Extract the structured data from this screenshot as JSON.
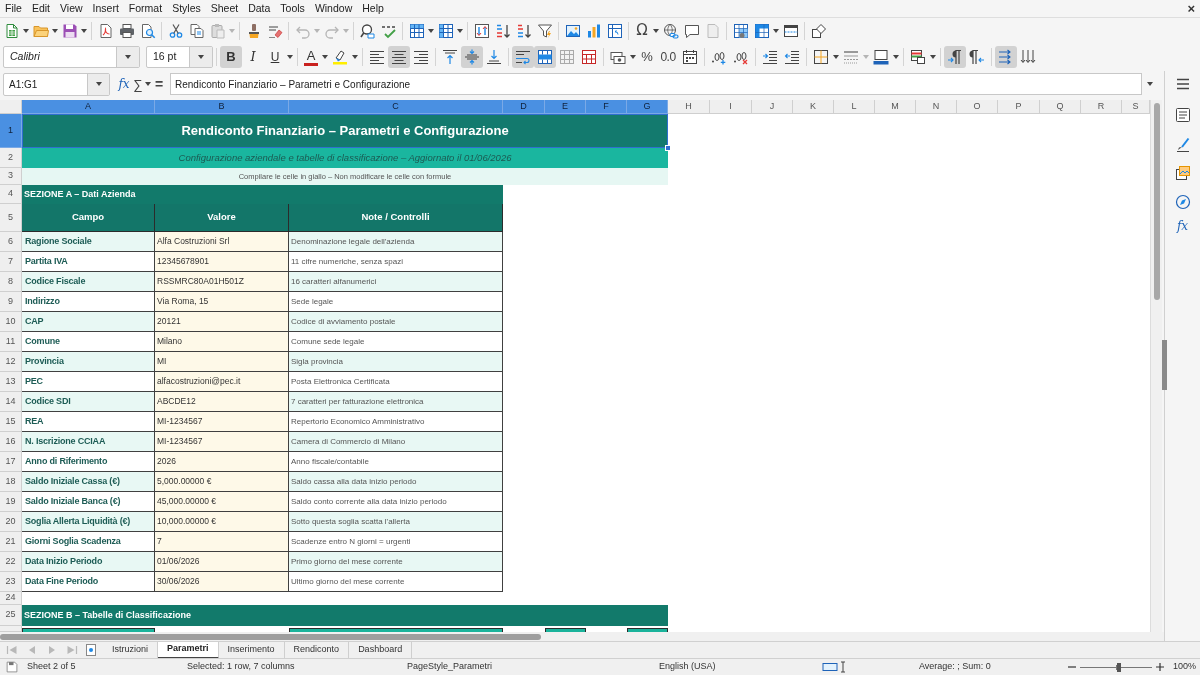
{
  "menu_bar": {
    "items": [
      "File",
      "Edit",
      "View",
      "Insert",
      "Format",
      "Styles",
      "Sheet",
      "Data",
      "Tools",
      "Window",
      "Help"
    ],
    "close_label": "×"
  },
  "standard_toolbar": {
    "special_character_label": "Ω"
  },
  "formatting_toolbar": {
    "font_name": "Calibri",
    "font_size": "16 pt",
    "text_styles": [
      {
        "kind": "bold",
        "label": "B",
        "on": true
      },
      {
        "kind": "italic",
        "label": "I",
        "on": false
      },
      {
        "kind": "underline",
        "label": "U",
        "on": false
      }
    ],
    "font_color_label": "A",
    "horizontal_align": [
      {
        "kind": "left",
        "selected": false
      },
      {
        "kind": "center",
        "selected": true
      },
      {
        "kind": "right",
        "selected": false
      }
    ],
    "vertical_align": [
      {
        "kind": "top",
        "selected": false
      },
      {
        "kind": "middle",
        "selected": true
      },
      {
        "kind": "bottom",
        "selected": false
      }
    ],
    "wrap_text": {
      "on": true
    },
    "merge_and_center": {
      "on": true
    },
    "percent_label": "%",
    "decimal_label": "0.0",
    "paragraph_direction": [
      {
        "kind": "left_to_right",
        "selected": true
      },
      {
        "kind": "right_to_left",
        "selected": false
      }
    ],
    "text_direction": [
      {
        "kind": "left_to_right",
        "selected": true
      },
      {
        "kind": "top_to_bottom",
        "selected": false
      }
    ]
  },
  "formula_bar": {
    "cell_reference": "A1:G1",
    "function_wizard_label": "fx",
    "sum_label": "∑",
    "formula_label": "=",
    "content": "Rendiconto Finanziario – Parametri e Configurazione"
  },
  "sidebar": {
    "functions_label": "fx"
  },
  "sheet": {
    "columns": [
      {
        "label": "A",
        "selected": true
      },
      {
        "label": "B",
        "selected": true
      },
      {
        "label": "C",
        "selected": true
      },
      {
        "label": "D",
        "selected": true
      },
      {
        "label": "E",
        "selected": true
      },
      {
        "label": "F",
        "selected": true
      },
      {
        "label": "G",
        "selected": true
      },
      {
        "label": "H",
        "selected": false
      },
      {
        "label": "I",
        "selected": false
      },
      {
        "label": "J",
        "selected": false
      },
      {
        "label": "K",
        "selected": false
      },
      {
        "label": "L",
        "selected": false
      },
      {
        "label": "M",
        "selected": false
      },
      {
        "label": "N",
        "selected": false
      },
      {
        "label": "O",
        "selected": false
      },
      {
        "label": "P",
        "selected": false
      },
      {
        "label": "Q",
        "selected": false
      },
      {
        "label": "R",
        "selected": false
      },
      {
        "label": "S",
        "selected": false
      }
    ],
    "rows": [
      {
        "number": "1",
        "selected": true,
        "kind": "title",
        "text": "Rendiconto Finanziario – Parametri e Configurazione"
      },
      {
        "number": "2",
        "selected": false,
        "kind": "subtitle",
        "text": "Configurazione aziendale e tabelle di classificazione – Aggiornato il 01/06/2026"
      },
      {
        "number": "3",
        "selected": false,
        "kind": "note",
        "text": "Compilare le celle in giallo – Non modificare le celle con formule"
      },
      {
        "number": "4",
        "selected": false,
        "kind": "section",
        "text": "SEZIONE A – Dati Azienda"
      },
      {
        "number": "5",
        "selected": false,
        "kind": "header",
        "cells": [
          "Campo",
          "Valore",
          "Note / Controlli"
        ]
      },
      {
        "number": "6",
        "selected": false,
        "kind": "field",
        "cells": [
          "Ragione Sociale",
          "Alfa Costruzioni Srl",
          "Denominazione legale dell'azienda"
        ]
      },
      {
        "number": "7",
        "selected": false,
        "kind": "field",
        "cells": [
          "Partita IVA",
          "12345678901",
          "11 cifre numeriche, senza spazi"
        ]
      },
      {
        "number": "8",
        "selected": false,
        "kind": "field",
        "cells": [
          "Codice Fiscale",
          "RSSMRC80A01H501Z",
          "16 caratteri alfanumerici"
        ]
      },
      {
        "number": "9",
        "selected": false,
        "kind": "field",
        "cells": [
          "Indirizzo",
          "Via Roma, 15",
          "Sede legale"
        ]
      },
      {
        "number": "10",
        "selected": false,
        "kind": "field",
        "cells": [
          "CAP",
          "20121",
          "Codice di avviamento postale"
        ]
      },
      {
        "number": "11",
        "selected": false,
        "kind": "field",
        "cells": [
          "Comune",
          "Milano",
          "Comune sede legale"
        ]
      },
      {
        "number": "12",
        "selected": false,
        "kind": "field",
        "cells": [
          "Provincia",
          "MI",
          "Sigla provincia"
        ]
      },
      {
        "number": "13",
        "selected": false,
        "kind": "field",
        "cells": [
          "PEC",
          "alfacostruzioni@pec.it",
          "Posta Elettronica Certificata"
        ]
      },
      {
        "number": "14",
        "selected": false,
        "kind": "field",
        "cells": [
          "Codice SDI",
          "ABCDE12",
          "7 caratteri per fatturazione elettronica"
        ]
      },
      {
        "number": "15",
        "selected": false,
        "kind": "field",
        "cells": [
          "REA",
          "MI-1234567",
          "Repertorio Economico Amministrativo"
        ]
      },
      {
        "number": "16",
        "selected": false,
        "kind": "field",
        "cells": [
          "N. Iscrizione CCIAA",
          "MI-1234567",
          "Camera di Commercio di Milano"
        ]
      },
      {
        "number": "17",
        "selected": false,
        "kind": "field",
        "cells": [
          "Anno di Riferimento",
          "2026",
          "Anno fiscale/contabile"
        ]
      },
      {
        "number": "18",
        "selected": false,
        "kind": "field",
        "cells": [
          "Saldo Iniziale Cassa (€)",
          "5,000.00000 €",
          "Saldo cassa alla data inizio periodo"
        ]
      },
      {
        "number": "19",
        "selected": false,
        "kind": "field",
        "cells": [
          "Saldo Iniziale Banca (€)",
          "45,000.00000 €",
          "Saldo conto corrente alla data inizio periodo"
        ]
      },
      {
        "number": "20",
        "selected": false,
        "kind": "field",
        "cells": [
          "Soglia Allerta Liquidità (€)",
          "10,000.00000 €",
          "Sotto questa soglia scatta l'allerta"
        ]
      },
      {
        "number": "21",
        "selected": false,
        "kind": "field",
        "cells": [
          "Giorni Soglia Scadenza",
          "7",
          "Scadenze entro N giorni = urgenti"
        ]
      },
      {
        "number": "22",
        "selected": false,
        "kind": "field",
        "cells": [
          "Data Inizio Periodo",
          "01/06/2026",
          "Primo giorno del mese corrente"
        ]
      },
      {
        "number": "23",
        "selected": false,
        "kind": "field",
        "cells": [
          "Data Fine Periodo",
          "30/06/2026",
          "Ultimo giorno del mese corrente"
        ]
      },
      {
        "number": "24",
        "selected": false,
        "kind": "blank"
      },
      {
        "number": "25",
        "selected": false,
        "kind": "band",
        "text": "SEZIONE B – Tabelle di Classificazione"
      },
      {
        "selected": false,
        "kind": "partial"
      }
    ]
  },
  "sheet_tabs": [
    {
      "label": "Istruzioni",
      "selected": false
    },
    {
      "label": "Parametri",
      "selected": true
    },
    {
      "label": "Inserimento",
      "selected": false
    },
    {
      "label": "Rendiconto",
      "selected": false
    },
    {
      "label": "Dashboard",
      "selected": false
    }
  ],
  "status_bar": {
    "sheet": "Sheet 2 of 5",
    "selection": "Selected: 1 row, 7 columns",
    "page_style": "PageStyle_Parametri",
    "language": "English (USA)",
    "summary": "Average: ; Sum: 0",
    "zoom_slider": {
      "level": 0.54
    },
    "zoom": "100%"
  }
}
